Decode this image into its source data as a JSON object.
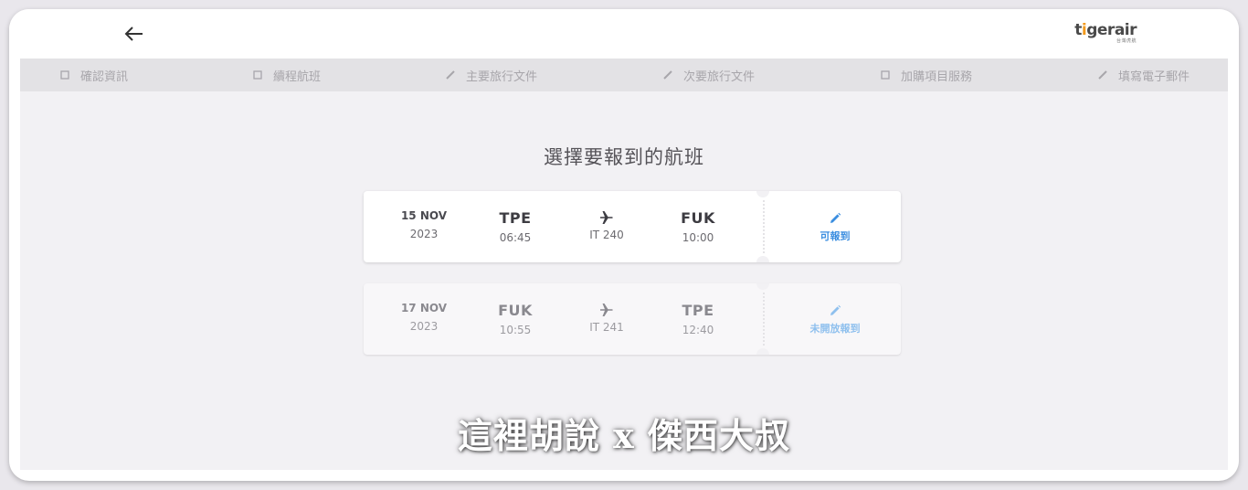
{
  "header": {
    "back_icon": "arrow-left-icon",
    "logo_text_pre": "t",
    "logo_text_i": "i",
    "logo_text_post": "gerair",
    "logo_sub": "台灣虎航"
  },
  "steps": [
    {
      "label": "確認資訊",
      "icon": "checkbox-icon"
    },
    {
      "label": "續程航班",
      "icon": "checkbox-icon"
    },
    {
      "label": "主要旅行文件",
      "icon": "pencil-icon"
    },
    {
      "label": "次要旅行文件",
      "icon": "pencil-icon"
    },
    {
      "label": "加購項目服務",
      "icon": "checkbox-icon"
    },
    {
      "label": "填寫電子郵件",
      "icon": "pencil-icon"
    }
  ],
  "main": {
    "title": "選擇要報到的航班",
    "flights": [
      {
        "date_day": "15 NOV",
        "date_year": "2023",
        "origin": "TPE",
        "depart_time": "06:45",
        "flight_no": "IT 240",
        "destination": "FUK",
        "arrive_time": "10:00",
        "action_label": "可報到"
      },
      {
        "date_day": "17 NOV",
        "date_year": "2023",
        "origin": "FUK",
        "depart_time": "10:55",
        "flight_no": "IT 241",
        "destination": "TPE",
        "arrive_time": "12:40",
        "action_label": "未開放報到"
      }
    ]
  },
  "watermark": "這裡胡說 x 傑西大叔",
  "colors": {
    "accent": "#3b8ee0",
    "accent_disabled": "#8fc0ee",
    "logo_orange": "#f39a1d",
    "step_bar": "#e3e2e5",
    "background": "#f2f1f4"
  }
}
